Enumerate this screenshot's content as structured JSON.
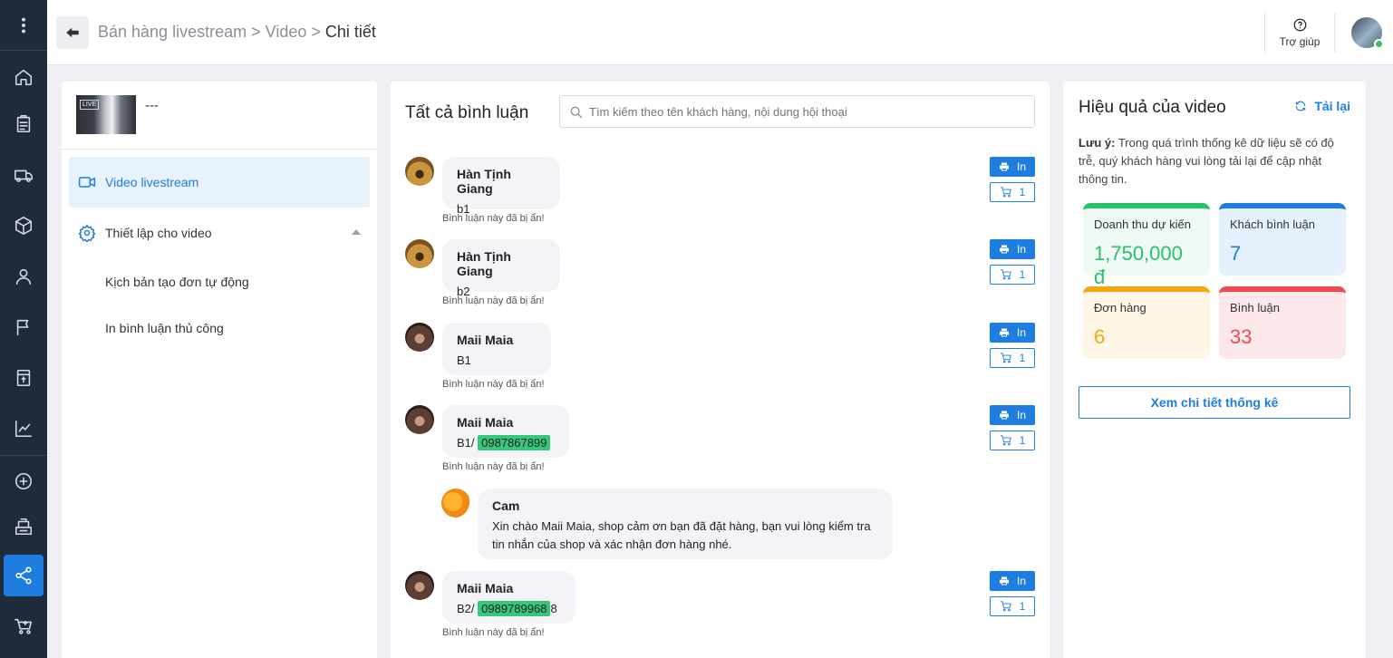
{
  "breadcrumb": {
    "part1": "Bán hàng livestream",
    "sep": ">",
    "part2": "Video",
    "current": "Chi tiết"
  },
  "header": {
    "help_label": "Trợ giúp"
  },
  "left_panel": {
    "video_name": "---",
    "live_label": "LIVE",
    "menu": {
      "video_livestream": "Video livestream",
      "settings": "Thiết lập cho video",
      "auto_order_script": "Kịch bản tạo đơn tự động",
      "manual_print": "In bình luận thủ công"
    }
  },
  "comments": {
    "title": "Tất cả bình luận",
    "search_placeholder": "Tìm kiếm theo tên khách hàng, nội dung hội thoại",
    "hidden_note": "Bình luận này đã bị ẩn!",
    "print_label": "In",
    "items": [
      {
        "name": "Hàn Tịnh Giang",
        "text": "b1",
        "cart": "1"
      },
      {
        "name": "Hàn Tịnh Giang",
        "text": "b2",
        "cart": "1"
      },
      {
        "name": "Maii Maia",
        "text": "B1",
        "cart": "1"
      },
      {
        "name": "Maii Maia",
        "text": "B1/ ",
        "phone": "0987867899",
        "cart": "1"
      },
      {
        "name": "Maii Maia",
        "text": "B2/ ",
        "phone": "0989789968",
        "suffix": "8",
        "cart": "1"
      }
    ],
    "reply": {
      "name": "Cam",
      "text": "Xin chào Maii Maia, shop cảm ơn bạn đã đặt hàng, bạn vui lòng kiểm tra tin nhắn của shop và xác nhận đơn hàng nhé."
    }
  },
  "stats_panel": {
    "title": "Hiệu quả của video",
    "reload_label": "Tải lại",
    "note_bold": "Lưu ý:",
    "note_text": " Trong quá trình thống kê dữ liệu sẽ có độ trễ, quý khách hàng vui lòng tải lại để cập nhật thông tin.",
    "cards": [
      {
        "label": "Doanh thu dự kiến",
        "value": "1,750,000 đ",
        "color": "#27c26c"
      },
      {
        "label": "Khách bình luận",
        "value": "7",
        "color": "#1e7ee0"
      },
      {
        "label": "Đơn hàng",
        "value": "6",
        "color": "#f5a611"
      },
      {
        "label": "Bình luận",
        "value": "33",
        "color": "#ef4a4f"
      }
    ],
    "detail_button": "Xem chi tiết thống kê"
  },
  "sidebar_icons": [
    "more-icon",
    "home-icon",
    "orders-icon",
    "shipping-icon",
    "product-icon",
    "customer-icon",
    "flag-icon",
    "cashbook-icon",
    "report-icon",
    "add-icon",
    "pos-icon",
    "share-icon",
    "cart-icon"
  ]
}
